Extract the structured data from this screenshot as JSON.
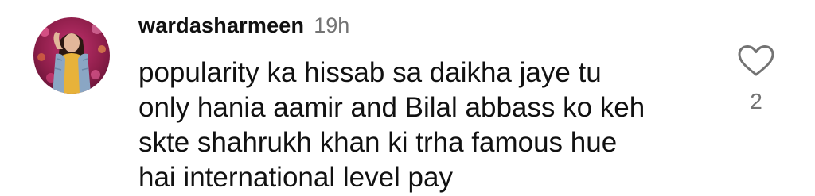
{
  "comment": {
    "avatar_icon": "profile-photo",
    "username": "wardasharmeen",
    "timestamp": "19h",
    "text": "popularity ka hissab sa daikha jaye tu\nonly hania aamir and Bilal abbass ko keh\nskte shahrukh khan ki  trha famous hue\nhai international level pay",
    "like_icon": "heart-outline-icon",
    "like_count": "2"
  },
  "colors": {
    "text_primary": "#111111",
    "text_secondary": "#737373",
    "background": "#ffffff"
  }
}
